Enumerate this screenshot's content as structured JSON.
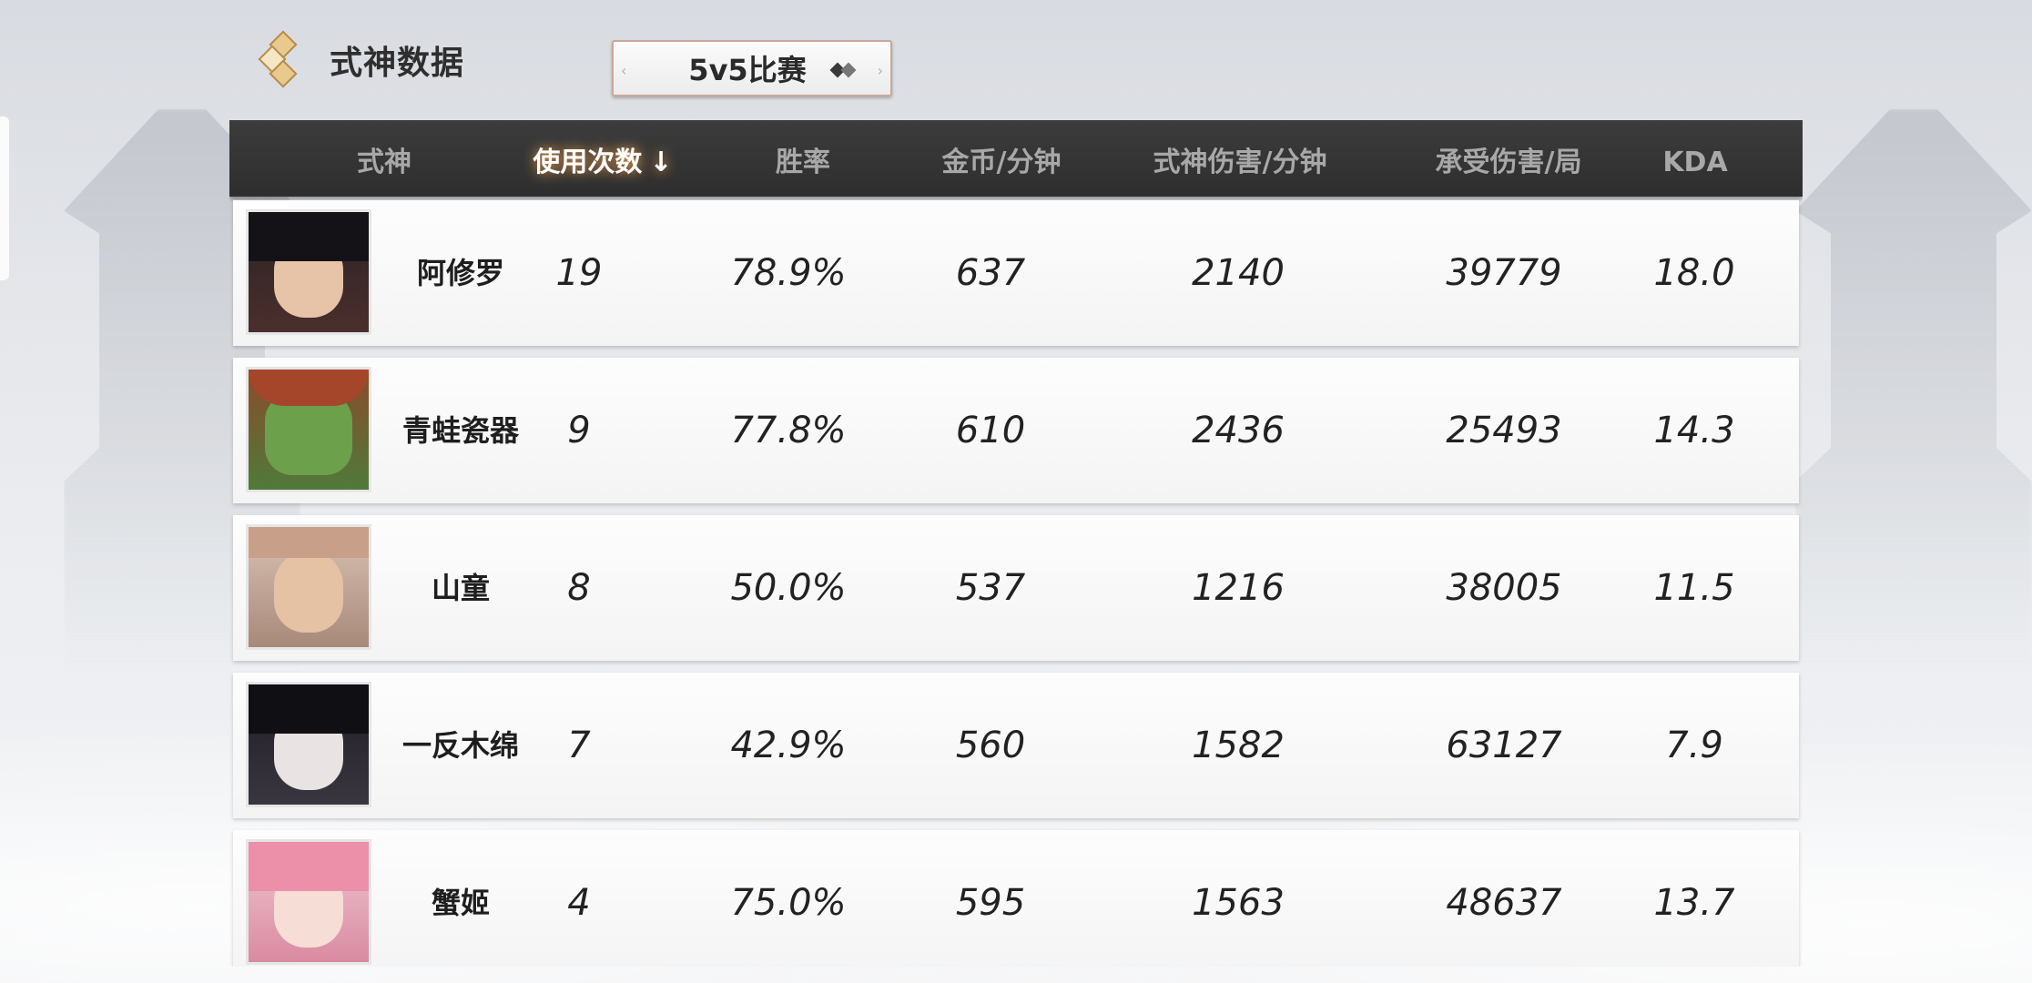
{
  "page_title": "式神数据",
  "mode_selector": {
    "label": "5v5比赛"
  },
  "table": {
    "headers": [
      "式神",
      "使用次数",
      "胜率",
      "金币/分钟",
      "式神伤害/分钟",
      "承受伤害/局",
      "KDA"
    ],
    "sort_column": "使用次数",
    "rows": [
      {
        "name": "阿修罗",
        "uses": "19",
        "win_rate": "78.9%",
        "gold_per_min": "637",
        "damage_per_min": "2140",
        "damage_taken": "39779",
        "kda": "18.0",
        "avatar": "asura-portrait"
      },
      {
        "name": "青蛙瓷器",
        "uses": "9",
        "win_rate": "77.8%",
        "gold_per_min": "610",
        "damage_per_min": "2436",
        "damage_taken": "25493",
        "kda": "14.3",
        "avatar": "frog-portrait"
      },
      {
        "name": "山童",
        "uses": "8",
        "win_rate": "50.0%",
        "gold_per_min": "537",
        "damage_per_min": "1216",
        "damage_taken": "38005",
        "kda": "11.5",
        "avatar": "yamawaro-portrait"
      },
      {
        "name": "一反木绵",
        "uses": "7",
        "win_rate": "42.9%",
        "gold_per_min": "560",
        "damage_per_min": "1582",
        "damage_taken": "63127",
        "kda": "7.9",
        "avatar": "ittan-momen-portrait"
      },
      {
        "name": "蟹姬",
        "uses": "4",
        "win_rate": "75.0%",
        "gold_per_min": "595",
        "damage_per_min": "1563",
        "damage_taken": "48637",
        "kda": "13.7",
        "avatar": "kani-hime-portrait"
      }
    ]
  },
  "colors": {
    "header_bg": "#333333",
    "header_text": "#a8a8a8",
    "active_header_glow": "#ffaa50",
    "row_bg": "#f8f8f8"
  }
}
